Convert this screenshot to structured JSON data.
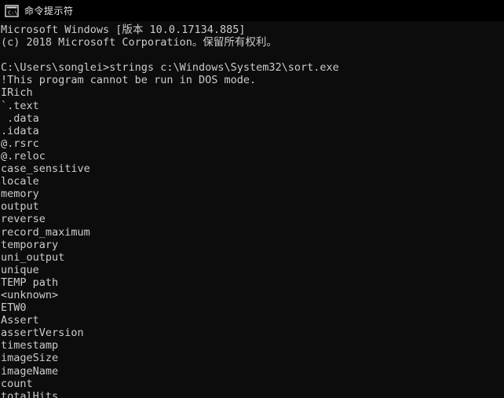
{
  "window": {
    "title": "命令提示符",
    "icon": "console-cmd-icon",
    "titlebar_bg": "#000000",
    "console_bg": "#0c0c0c",
    "console_fg": "#cccccc"
  },
  "console": {
    "lines": [
      "Microsoft Windows [版本 10.0.17134.885]",
      "(c) 2018 Microsoft Corporation。保留所有权利。",
      "",
      "C:\\Users\\songlei>strings c:\\Windows\\System32\\sort.exe",
      "!This program cannot be run in DOS mode.",
      "IRich",
      "`.text",
      " .data",
      ".idata",
      "@.rsrc",
      "@.reloc",
      "case_sensitive",
      "locale",
      "memory",
      "output",
      "reverse",
      "record_maximum",
      "temporary",
      "uni_output",
      "unique",
      "TEMP path",
      "<unknown>",
      "ETW0",
      "Assert",
      "assertVersion",
      "timestamp",
      "imageSize",
      "imageName",
      "count",
      "totalHits"
    ]
  }
}
